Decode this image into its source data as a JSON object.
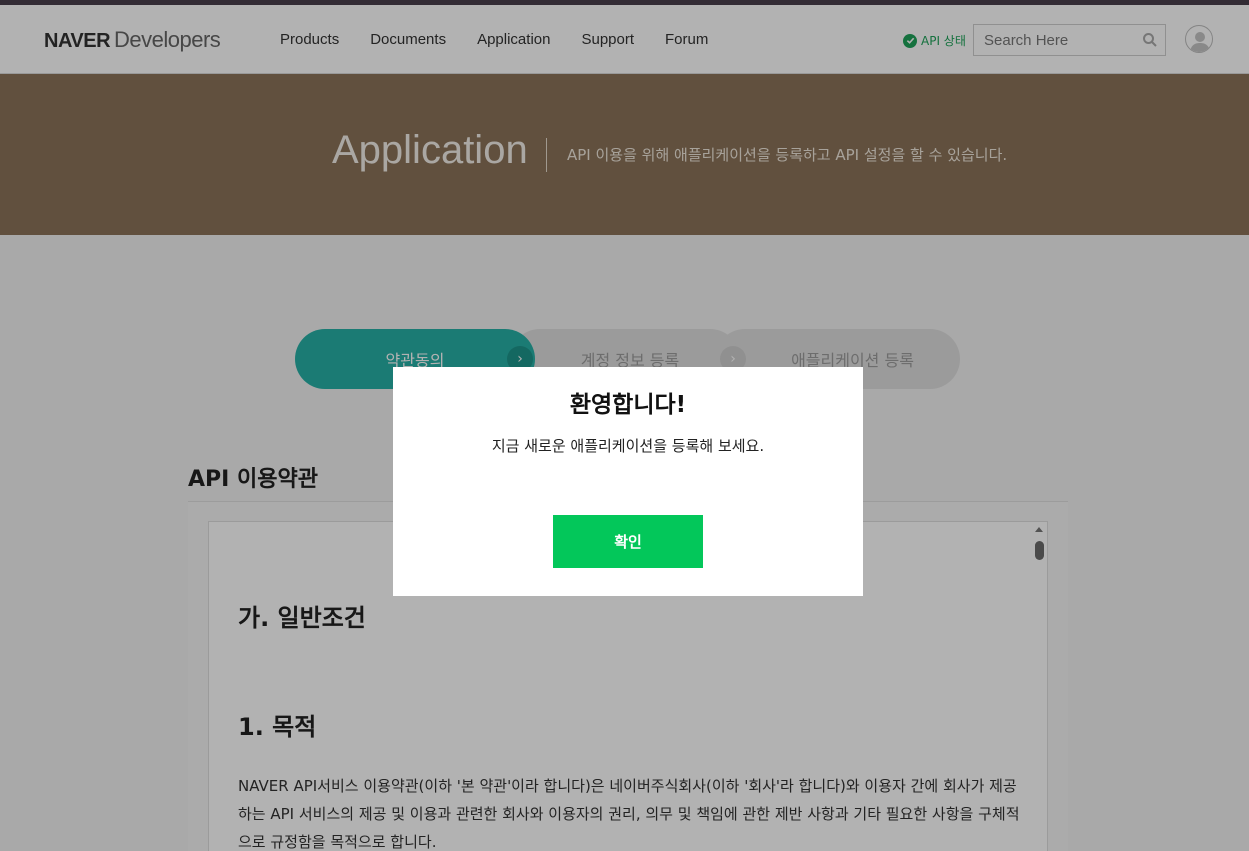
{
  "header": {
    "logo_brand": "NAVER",
    "logo_suffix": "Developers",
    "nav": [
      "Products",
      "Documents",
      "Application",
      "Support",
      "Forum"
    ],
    "api_status_label": "API 상태",
    "search_placeholder": "Search Here"
  },
  "hero": {
    "title": "Application",
    "description": "API 이용을 위해 애플리케이션을 등록하고 API 설정을 할 수 있습니다."
  },
  "steps": [
    {
      "label": "약관동의",
      "active": true
    },
    {
      "label": "계정 정보 등록",
      "active": false
    },
    {
      "label": "애플리케이션 등록",
      "active": false
    }
  ],
  "terms": {
    "section_title": "API 이용약관",
    "heading": "가. 일반조건",
    "subheading": "1. 목적",
    "body": "NAVER API서비스 이용약관(이하 '본 약관'이라 합니다)은 네이버주식회사(이하 '회사'라 합니다)와 이용자 간에 회사가 제공하는 API 서비스의 제공 및 이용과 관련한 회사와 이용자의 권리, 의무 및 책임에 관한 제반 사항과 기타 필요한 사항을 구체적으로 규정함을 목적으로 합니다."
  },
  "modal": {
    "title": "환영합니다!",
    "message": "지금 새로운 애플리케이션을 등록해 보세요.",
    "confirm_label": "확인"
  },
  "colors": {
    "hero_bg": "#8c7359",
    "active_step": "#27b0a6",
    "confirm_button": "#03c75a",
    "status_green": "#1fa35a"
  }
}
